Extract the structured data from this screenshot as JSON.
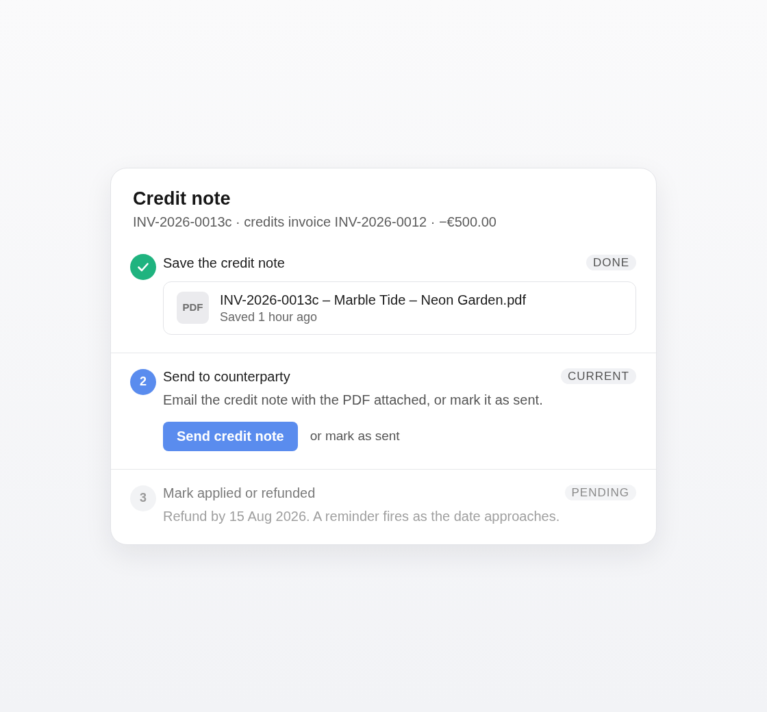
{
  "card": {
    "title": "Credit note",
    "subtitle": "INV-2026-0013c · credits invoice INV-2026-0012 · −€500.00"
  },
  "steps": [
    {
      "kind": "done",
      "title": "Save the credit note",
      "badge": "DONE",
      "attachment": {
        "type_label": "PDF",
        "filename": "INV-2026-0013c – Marble Tide – Neon Garden.pdf",
        "meta": "Saved 1 hour ago"
      }
    },
    {
      "kind": "current",
      "marker": "2",
      "title": "Send to counterparty",
      "badge": "CURRENT",
      "description": "Email the credit note with the PDF attached, or mark it as sent.",
      "primary_action": "Send credit note",
      "secondary_action": "or mark as sent"
    },
    {
      "kind": "pending",
      "marker": "3",
      "title": "Mark applied or refunded",
      "badge": "PENDING",
      "description": "Refund by 15 Aug 2026. A reminder fires as the date approaches."
    }
  ]
}
